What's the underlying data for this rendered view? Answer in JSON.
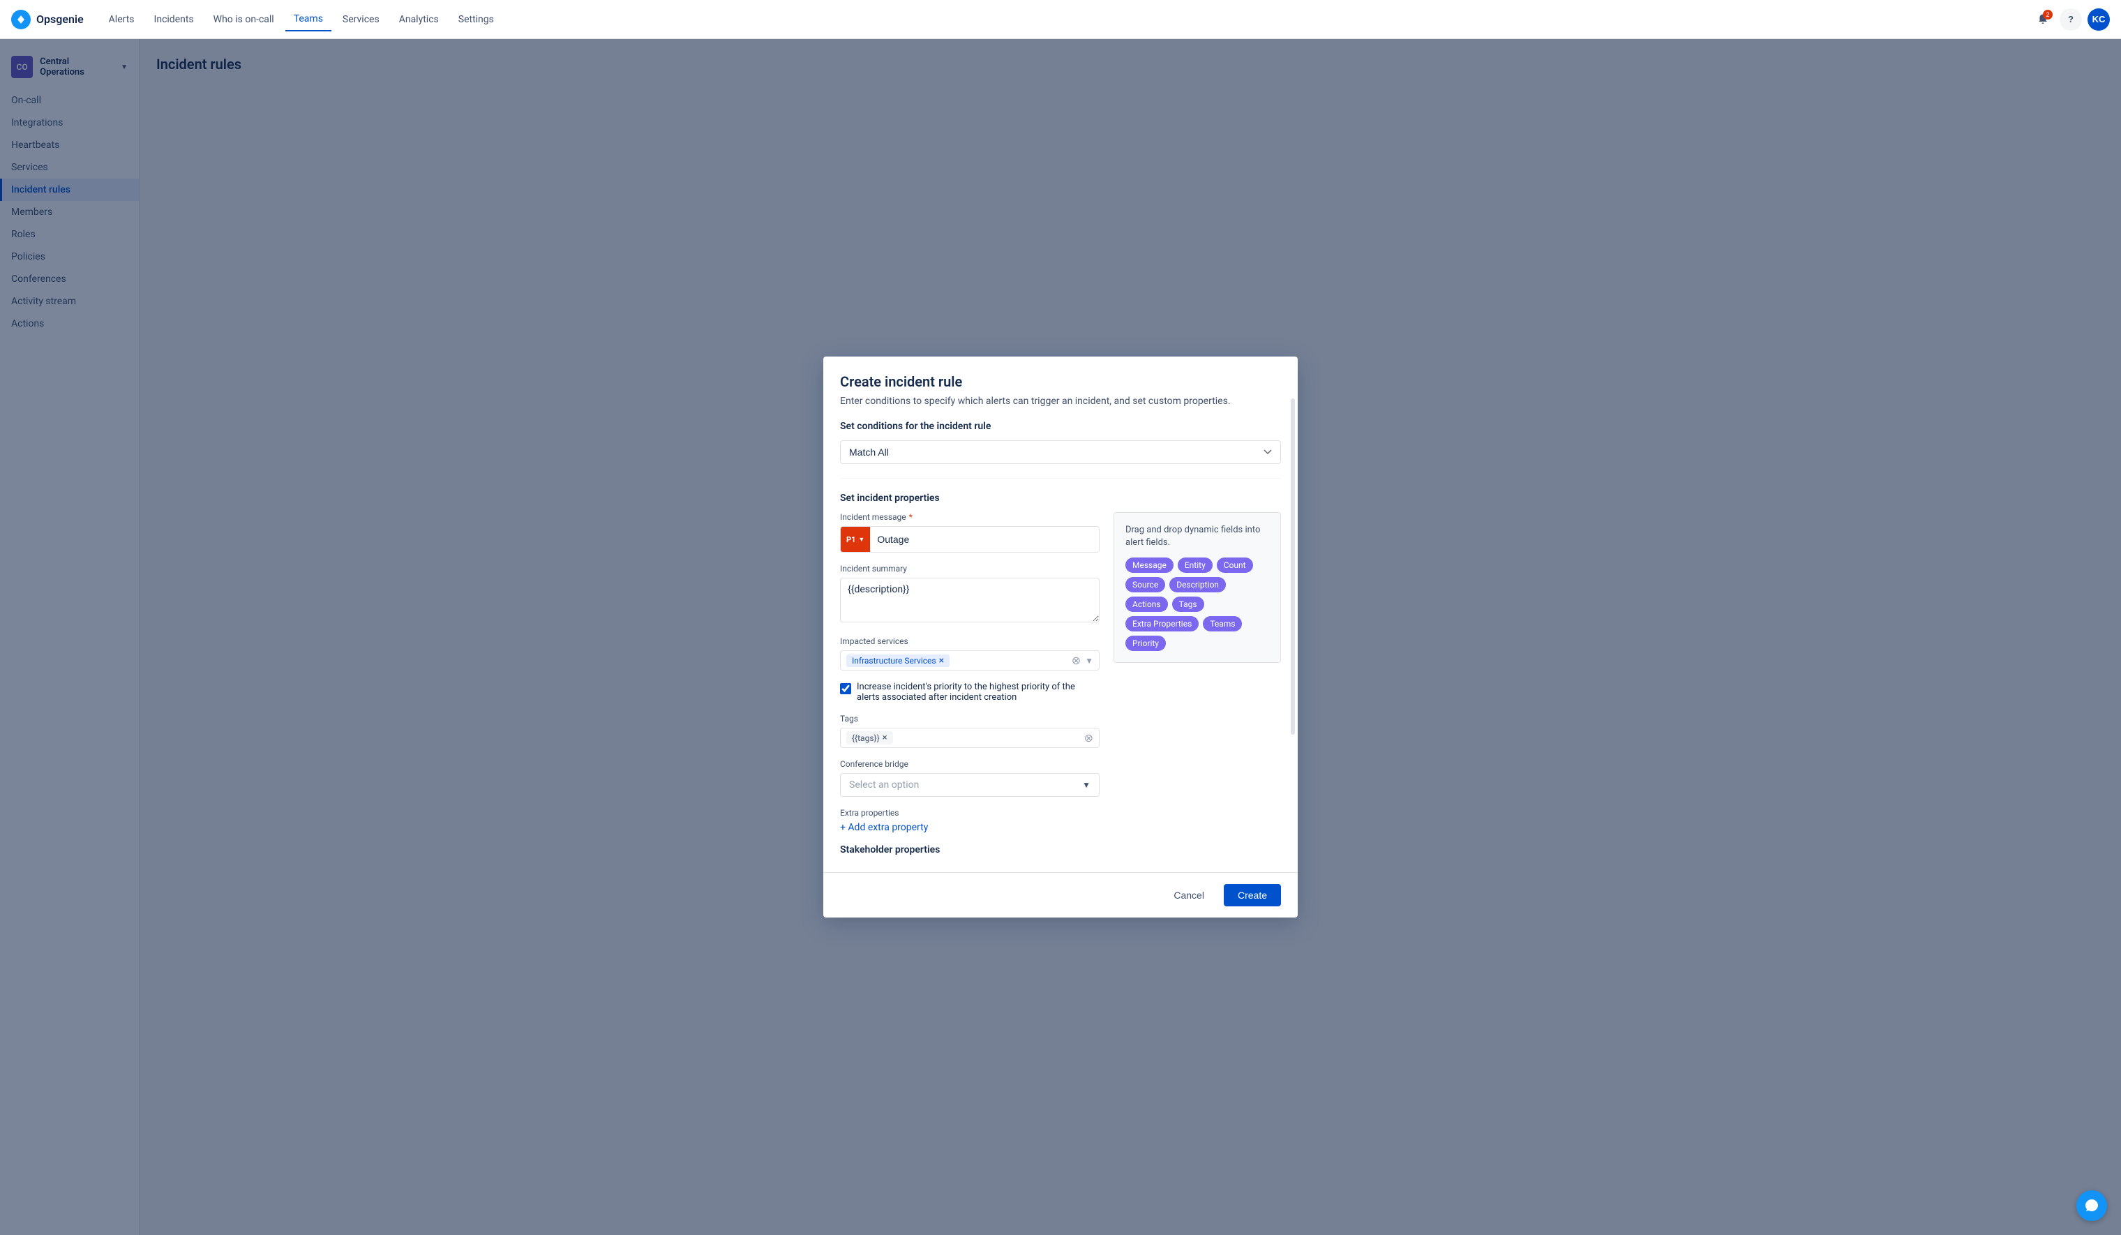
{
  "app": {
    "logo_text": "Opsgenie"
  },
  "topnav": {
    "links": [
      {
        "id": "alerts",
        "label": "Alerts",
        "active": false
      },
      {
        "id": "incidents",
        "label": "Incidents",
        "active": false
      },
      {
        "id": "who-is-on-call",
        "label": "Who is on-call",
        "active": false
      },
      {
        "id": "teams",
        "label": "Teams",
        "active": true
      },
      {
        "id": "services",
        "label": "Services",
        "active": false
      },
      {
        "id": "analytics",
        "label": "Analytics",
        "active": false
      },
      {
        "id": "settings",
        "label": "Settings",
        "active": false
      }
    ],
    "notif_count": "2",
    "avatar_text": "KC"
  },
  "sidebar": {
    "team_name": "Central Operations",
    "team_initials": "CO",
    "items": [
      {
        "id": "on-call",
        "label": "On-call",
        "active": false
      },
      {
        "id": "integrations",
        "label": "Integrations",
        "active": false
      },
      {
        "id": "heartbeats",
        "label": "Heartbeats",
        "active": false
      },
      {
        "id": "services",
        "label": "Services",
        "active": false
      },
      {
        "id": "incident-rules",
        "label": "Incident rules",
        "active": true
      },
      {
        "id": "members",
        "label": "Members",
        "active": false
      },
      {
        "id": "roles",
        "label": "Roles",
        "active": false
      },
      {
        "id": "policies",
        "label": "Policies",
        "active": false
      },
      {
        "id": "conferences",
        "label": "Conferences",
        "active": false
      },
      {
        "id": "activity-stream",
        "label": "Activity stream",
        "active": false
      },
      {
        "id": "actions",
        "label": "Actions",
        "active": false
      }
    ]
  },
  "page": {
    "title": "Incident rules"
  },
  "modal": {
    "title": "Create incident rule",
    "subtitle": "Enter conditions to specify which alerts can trigger an incident, and set custom properties.",
    "conditions_section": "Set conditions for the incident rule",
    "match_all_label": "Match All",
    "properties_section": "Set incident properties",
    "incident_message_label": "Incident message",
    "priority_label": "P1",
    "message_value": "Outage",
    "summary_label": "Incident summary",
    "summary_value": "{{description}}",
    "impacted_services_label": "Impacted services",
    "service_tag": "Infrastructure Services",
    "checkbox_label": "Increase incident's priority to the highest priority of the alerts associated after incident creation",
    "tags_label": "Tags",
    "tag_value": "{{tags}}",
    "conference_bridge_label": "Conference bridge",
    "conference_placeholder": "Select an option",
    "extra_properties_label": "Extra properties",
    "add_extra_label": "+ Add extra property",
    "stakeholder_title": "Stakeholder properties",
    "cancel_label": "Cancel",
    "create_label": "Create"
  },
  "dynamic_panel": {
    "title": "Drag and drop dynamic fields into alert fields.",
    "chips": [
      {
        "id": "message",
        "label": "Message"
      },
      {
        "id": "entity",
        "label": "Entity"
      },
      {
        "id": "count",
        "label": "Count"
      },
      {
        "id": "source",
        "label": "Source"
      },
      {
        "id": "description",
        "label": "Description"
      },
      {
        "id": "actions",
        "label": "Actions"
      },
      {
        "id": "tags",
        "label": "Tags"
      },
      {
        "id": "extra-properties",
        "label": "Extra Properties"
      },
      {
        "id": "teams",
        "label": "Teams"
      },
      {
        "id": "priority",
        "label": "Priority"
      }
    ]
  }
}
